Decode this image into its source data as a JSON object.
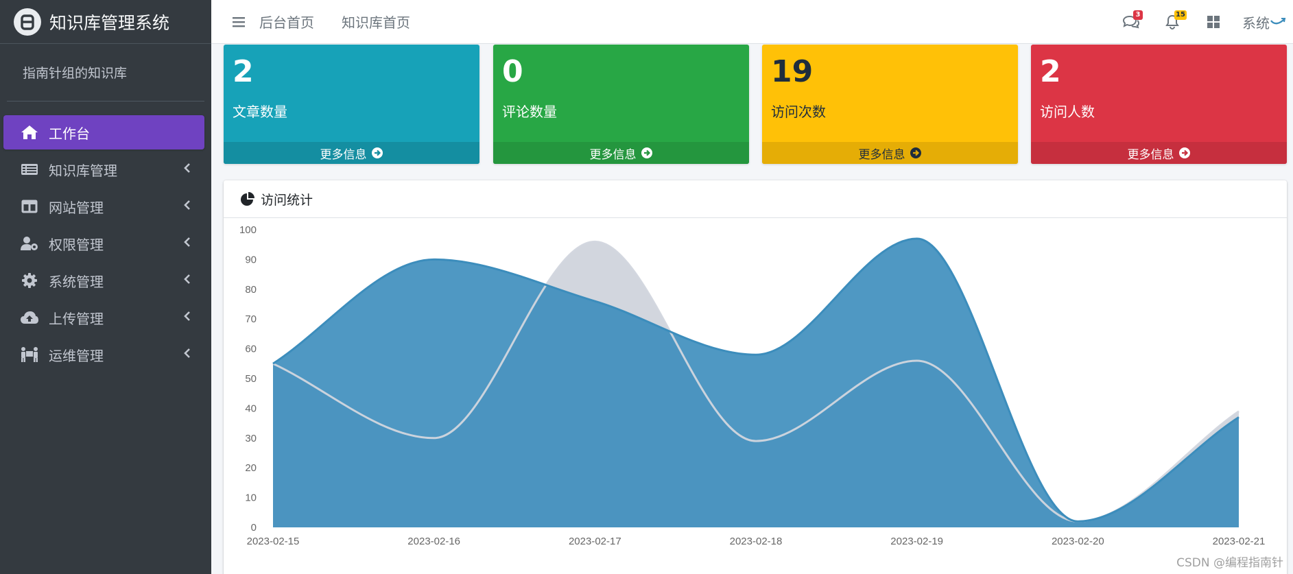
{
  "app": {
    "title": "知识库管理系统"
  },
  "user_panel": {
    "name": "指南针组的知识库"
  },
  "sidebar": {
    "items": [
      {
        "label": "工作台",
        "icon": "home-icon",
        "active": true,
        "has_arrow": false
      },
      {
        "label": "知识库管理",
        "icon": "list-icon",
        "active": false,
        "has_arrow": true
      },
      {
        "label": "网站管理",
        "icon": "columns-icon",
        "active": false,
        "has_arrow": true
      },
      {
        "label": "权限管理",
        "icon": "user-cog-icon",
        "active": false,
        "has_arrow": true
      },
      {
        "label": "系统管理",
        "icon": "gear-icon",
        "active": false,
        "has_arrow": true
      },
      {
        "label": "上传管理",
        "icon": "cloud-upload-icon",
        "active": false,
        "has_arrow": true
      },
      {
        "label": "运维管理",
        "icon": "people-carry-icon",
        "active": false,
        "has_arrow": true
      }
    ]
  },
  "header": {
    "links": [
      "后台首页",
      "知识库首页"
    ],
    "messages_badge": "3",
    "notifications_badge": "15",
    "user_label": "系统"
  },
  "stats": [
    {
      "value": "2",
      "label": "文章数量",
      "more": "更多信息",
      "color": "#17a2b8",
      "foot_color": "#148ea1",
      "text_color": "#ffffff"
    },
    {
      "value": "0",
      "label": "评论数量",
      "more": "更多信息",
      "color": "#28a745",
      "foot_color": "#24963e",
      "text_color": "#ffffff"
    },
    {
      "value": "19",
      "label": "访问次数",
      "more": "更多信息",
      "color": "#ffc107",
      "foot_color": "#e5ad06",
      "text_color": "#1f2d3d"
    },
    {
      "value": "2",
      "label": "访问人数",
      "more": "更多信息",
      "color": "#dc3545",
      "foot_color": "#c62f3e",
      "text_color": "#ffffff"
    }
  ],
  "card": {
    "title": "访问统计"
  },
  "chart_data": {
    "type": "area",
    "x": [
      "2023-02-15",
      "2023-02-16",
      "2023-02-17",
      "2023-02-18",
      "2023-02-19",
      "2023-02-20",
      "2023-02-21"
    ],
    "ylim": [
      0,
      100
    ],
    "yticks": [
      0,
      10,
      20,
      30,
      40,
      50,
      60,
      70,
      80,
      90,
      100
    ],
    "series": [
      {
        "values": [
          55,
          30,
          96,
          29,
          56,
          2,
          39
        ],
        "fill": "#d2d6de",
        "stroke": "#d2d6de"
      },
      {
        "values": [
          55,
          90,
          76,
          58,
          97,
          2,
          37
        ],
        "fill": "#3c8dbc",
        "stroke": "#3c8dbc"
      }
    ]
  },
  "watermark": "CSDN @编程指南针"
}
